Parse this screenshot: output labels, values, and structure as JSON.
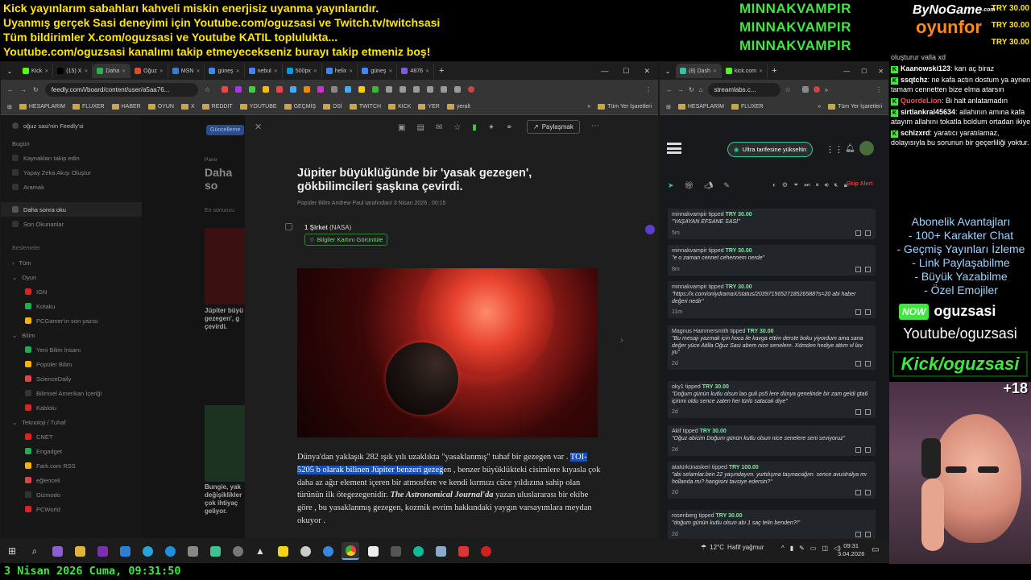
{
  "overlay": {
    "lines": [
      "Kick yayınlarım sabahları kahveli miskin enerjisiz uyanma yayınlarıdır.",
      "Uyanmış gerçek Sasi deneyimi için Youtube.com/oguzsasi ve Twitch.tv/twitchsasi",
      "Tüm bildirimler X.com/oguzsasi ve Youtube KATIL toplulukta...",
      "Youtube.com/oguzsasi kanalımı takip etmeyecekseniz burayı takip etmeniz boş!"
    ],
    "top_tippers": [
      "MINNAKVAMPIR",
      "MINNAKVAMPIR",
      "MINNAKVAMPIR"
    ],
    "sponsor_logo_top": "ByNoGame",
    "sponsor_logo_com": ".com",
    "sponsor_logo_bottom": "oyunfor",
    "top_amounts": [
      "TRY 30.00",
      "TRY 30.00",
      "TRY 30.00"
    ],
    "date_time": "3 Nisan 2026 Cuma, 09:31:50"
  },
  "browser1": {
    "tabs": [
      {
        "label": "Kick",
        "color": "#53fc18"
      },
      {
        "label": "(15) X",
        "color": "#000000"
      },
      {
        "label": "Daha",
        "color": "#2bb24c"
      },
      {
        "label": "Oğuz",
        "color": "#e14a2b"
      },
      {
        "label": "MSN",
        "color": "#3b7bd6"
      },
      {
        "label": "güneş",
        "color": "#4285f4"
      },
      {
        "label": "nebul",
        "color": "#4285f4"
      },
      {
        "label": "500px",
        "color": "#0099e5"
      },
      {
        "label": "helix",
        "color": "#4285f4"
      },
      {
        "label": "güneş",
        "color": "#4285f4"
      },
      {
        "label": "4876",
        "color": "#7b5be0"
      }
    ],
    "address": "feedly.com/i/board/content/user/a5aa76...",
    "bookmarks": [
      "HESAPLARIM",
      "FLUXER",
      "HABER",
      "OYUN",
      "X",
      "REDDIT",
      "YOUTUBE",
      "GEÇMİŞ",
      "DSİ",
      "TWITCH",
      "KICK",
      "YER",
      "yeralt"
    ],
    "bookmarks_all": "Tüm Yer İşaretleri"
  },
  "feedly": {
    "workspace": "oğuz sasi'nin Feedly'si",
    "nav": [
      "Bugün",
      "Kaynakları takip edin",
      "Yapay Zeka Akışı Oluştur",
      "Aramak"
    ],
    "saved": [
      "Daha sonra oku",
      "Son Okunanlar"
    ],
    "feeds_head": "Beslemeler",
    "all": "Tüm",
    "group_game": "Oyun",
    "game_feeds": [
      "IGN",
      "Kotaku",
      "PCGamer'ın son yazısı"
    ],
    "group_science": "Bilim",
    "science_feeds": [
      "Yeni Bilim İnsanı",
      "Popüler Bilim",
      "ScienceDaily",
      "Bilimsel Amerikan İçeriği",
      "Kablolu"
    ],
    "group_tech": "Teknoloji / Tuhaf",
    "tech_feeds": [
      "CNET",
      "Engadget",
      "Fark.com RSS",
      "eğlenceli",
      "Gizmodo",
      "PCWorld"
    ],
    "mid_button": "Güncelleme",
    "mid_board": "Pano",
    "mid_title": "Daha so",
    "mid_sub": "En sonuncu",
    "mid_card1": "Jüpiter büyü gezegen', g çevirdi.",
    "mid_card2": "Bungie, yak değişiklikler çok ihtiyaç geliyor.",
    "share_label": "Paylaşmak",
    "article": {
      "title": "Jüpiter büyüklüğünde bir 'yasak gezegen', gökbilimcileri şaşkına çevirdi.",
      "meta": "Popüler Bilim Andrew Paul tarafından/ 3 Nisan 2026 , 00:15",
      "entity": "1 Şirket",
      "entity_sub": "(NASA)",
      "entity_button": "Bilgiler Kartını Görüntüle",
      "body_1": "Dünya'dan yaklaşık 282 ışık yılı uzaklıkta \"yasaklanmış\" tuhaf bir gezegen var .",
      "body_hl": "TOI-5205 b olarak bilinen Jüpiter benzeri gezeg",
      "body_2": "en , benzer büyüklükteki cisimlere kıyasla çok daha az ağır element içeren bir atmosfere ve kendi kırmızı cüce yıldızına sahip olan türünün ilk ötegezegenidir.",
      "body_journal": "The Astronomical Journal'da",
      "body_3": "yazan uluslararası bir ekibe göre , bu yasaklanmış gezegen, kozmik evrim hakkındaki yaygın varsayımlara meydan okuyor ."
    }
  },
  "browser2": {
    "tabs": [
      {
        "label": "(8) Dash",
        "color": "#31c3a2"
      },
      {
        "label": "kick.com",
        "color": "#53fc18"
      }
    ],
    "address": "streamlabs.c...",
    "bookmarks": [
      "HESAPLARIM",
      "FLUXER"
    ],
    "bookmarks_all": "Tüm Yer İşaretleri",
    "upgrade": "Ultra tarifesine yükseltin",
    "skip": "Skip Alert",
    "alerts": [
      {
        "user": "minnakvampir",
        "verb": "tipped",
        "amount": "TRY 30.00",
        "msg": "\"YAŞAYAN EFSANE SASİ\"",
        "time": "5m"
      },
      {
        "user": "minnakvampir",
        "verb": "tipped",
        "amount": "TRY 30.00",
        "msg": "\"e o zaman cennet cehennem nerde\"",
        "time": "8m"
      },
      {
        "user": "minnakvampir",
        "verb": "tipped",
        "amount": "TRY 30.00",
        "msg": "\"https://x.com/onlydramaX/status/2039715652718526588?s=20 abi haber değeri nedir\"",
        "time": "11m"
      },
      {
        "user": "Magnus Hammersmith",
        "verb": "tipped",
        "amount": "TRY 30.00",
        "msg": "\"Bu mesajı yazmak için hoca ile kavga ettim derste boku yiyordum ama sana değer yüce Atilla Oğuz Sasi abem nice senelere. Xdmden hediye attım vl lav yu\"",
        "time": "2d"
      },
      {
        "user": "oky1",
        "verb": "tipped",
        "amount": "TRY 30.00",
        "msg": "\"Doğum günün kutlu olsun lao guli ps5 lere dünya genelinde bir zam geldi gta6 içinmi oldu sence zaten her türlü satacak diye\"",
        "time": "2d"
      },
      {
        "user": "Akif",
        "verb": "tipped",
        "amount": "TRY 30.00",
        "msg": "\"Oğuz abicim Doğum günün kutlu olsun nice senelere seni seviyoruz\"",
        "time": "2d"
      },
      {
        "user": "atatürkünaskeri",
        "verb": "tipped",
        "amount": "TRY 100.00",
        "msg": "\"abi selamlar.ben 22 yaşındayım. yurtdışına taşınacağım. sence avustralya mı hollanda mı? hangisini tavsiye edersin?\"",
        "time": "2d"
      },
      {
        "user": "rosenberg",
        "verb": "tipped",
        "amount": "TRY 30.00",
        "msg": "\"doğum günün kutlu olsun abi 1 saç telin benden?!\"",
        "time": "2d"
      }
    ]
  },
  "chat": {
    "top": "oluşturur valla xd",
    "messages": [
      {
        "user": "Kaanowski123",
        "color": "#ffffff",
        "text": ": karı aç biraz"
      },
      {
        "user": "ssqtchz",
        "color": "#ffffff",
        "text": ": ne kafa actın dostum ya aynen tamam cennetten bize elma atarsın"
      },
      {
        "user": "QuordeLion",
        "color": "#ff4d4d",
        "text": ": Bi halt anlatamadın"
      },
      {
        "user": "sirtlankral45634",
        "color": "#ffffff",
        "text": ": allahının amına kafa atayım allahını tokatla boldum ortadan ikiye"
      },
      {
        "user": "schizxrd",
        "color": "#ffffff",
        "text": ": yaratıcı yaratılamaz, dolayısıyla bu sorunun bir geçerliliği yoktur."
      }
    ]
  },
  "subs": {
    "lines": [
      "Abonelik Avantajları",
      "- 100+ Karakter Chat",
      "- Geçmiş Yayınları İzleme",
      "- Link Paylaşabilme",
      "- Büyük Yazabilme",
      "- Özel Emojiler"
    ],
    "now_badge": "NOW",
    "now_name": "oguzsasi",
    "youtube": "Youtube/oguzsasi",
    "kick": "Kick/oguzsasi",
    "age": "+18"
  },
  "taskbar": {
    "weather_temp": "12°C",
    "weather_text": "Hafif yağmur",
    "time": "09:31",
    "date": "3.04.2026"
  },
  "colors": {
    "accent_green": "#3ee83e",
    "overlay_yellow": "#ffe600",
    "streamlabs_green": "#7ee8a2",
    "skip_red": "#d9363e"
  }
}
